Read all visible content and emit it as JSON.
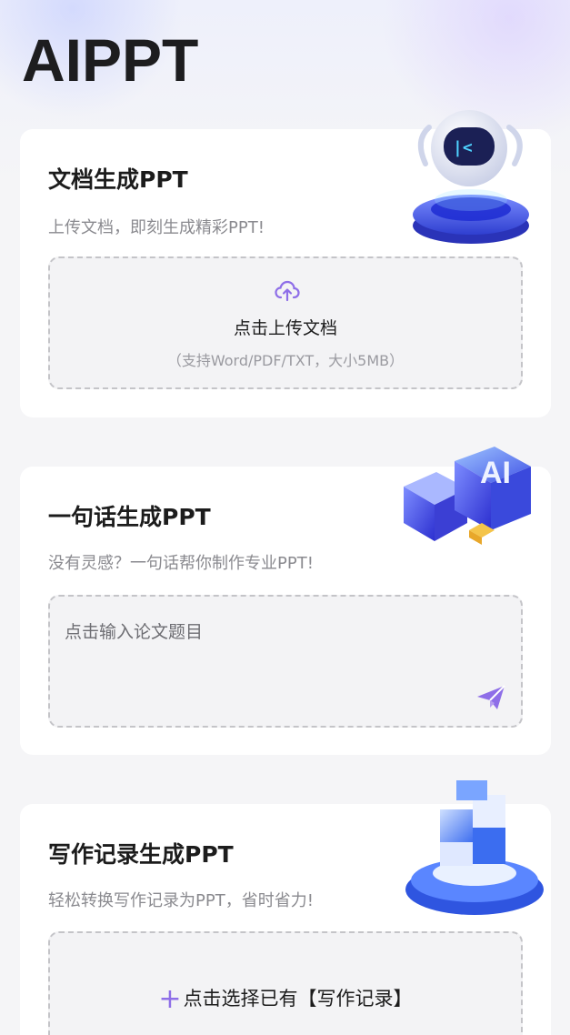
{
  "app": {
    "title": "AIPPT"
  },
  "cards": [
    {
      "title": "文档生成PPT",
      "description": "上传文档，即刻生成精彩PPT!",
      "upload_label": "点击上传文档",
      "upload_hint": "（支持Word/PDF/TXT，大小5MB）",
      "icon": "cloud-upload-icon"
    },
    {
      "title": "一句话生成PPT",
      "description": "没有灵感？一句话帮你制作专业PPT!",
      "input_placeholder": "点击输入论文题目",
      "input_value": "",
      "icon": "send-icon"
    },
    {
      "title": "写作记录生成PPT",
      "description": "轻松转换写作记录为PPT，省时省力!",
      "select_label": "点击选择已有【写作记录】",
      "icon": "plus-icon"
    }
  ],
  "colors": {
    "accent": "#8e6ee8",
    "card_bg": "#ffffff",
    "page_bg": "#f5f5f7",
    "dropzone_bg": "#f3f3f5",
    "illustration_blue": "#3b4fd8"
  }
}
